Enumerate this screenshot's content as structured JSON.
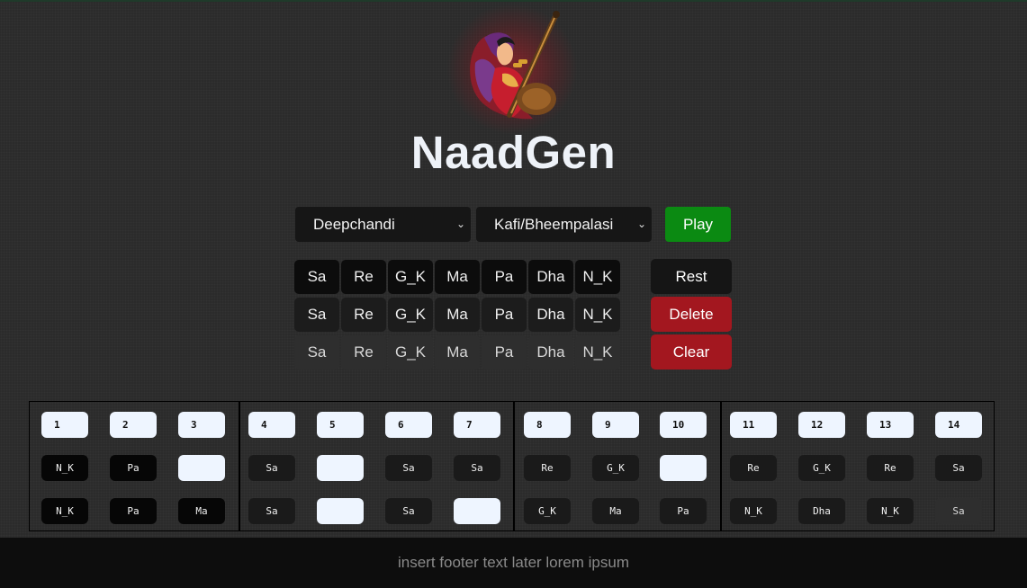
{
  "app": {
    "title": "NaadGen"
  },
  "controls": {
    "taal_select": "Deepchandi",
    "raag_select": "Kafi/Bheempalasi",
    "play_label": "Play"
  },
  "note_rows": [
    [
      "Sa",
      "Re",
      "G_K",
      "Ma",
      "Pa",
      "Dha",
      "N_K"
    ],
    [
      "Sa",
      "Re",
      "G_K",
      "Ma",
      "Pa",
      "Dha",
      "N_K"
    ],
    [
      "Sa",
      "Re",
      "G_K",
      "Ma",
      "Pa",
      "Dha",
      "N_K"
    ]
  ],
  "actions": {
    "rest": "Rest",
    "delete": "Delete",
    "clear": "Clear"
  },
  "composition": {
    "beats": [
      "1",
      "2",
      "3",
      "4",
      "5",
      "6",
      "7",
      "8",
      "9",
      "10",
      "11",
      "12",
      "13",
      "14"
    ],
    "row1": [
      "N_K",
      "Pa",
      "",
      "Sa",
      "",
      "Sa",
      "Sa",
      "Re",
      "G_K",
      "",
      "Re",
      "G_K",
      "Re",
      "Sa"
    ],
    "row2": [
      "N_K",
      "Pa",
      "Ma",
      "Sa",
      "",
      "Sa",
      "",
      "G_K",
      "Ma",
      "Pa",
      "N_K",
      "Dha",
      "N_K",
      "Sa"
    ]
  },
  "footer": {
    "text": "insert footer text later lorem ipsum"
  },
  "colors": {
    "play": "#0b8a12",
    "danger": "#a3171f",
    "background": "#2b2b2b"
  }
}
